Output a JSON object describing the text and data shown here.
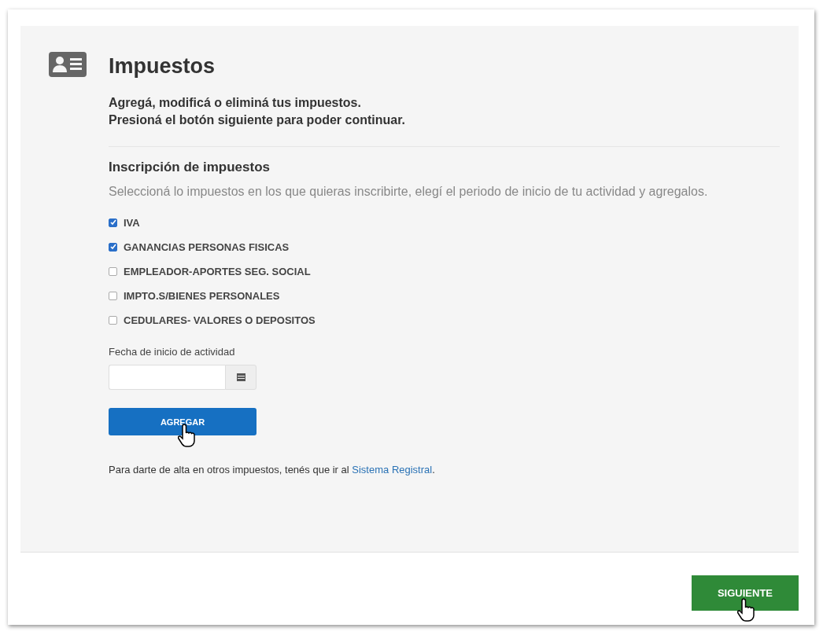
{
  "header": {
    "title": "Impuestos",
    "subtitle": [
      "Agregá, modificá o eliminá tus impuestos.",
      "Presioná el botón siguiente para poder continuar."
    ]
  },
  "section": {
    "title": "Inscripción de impuestos",
    "description": "Seleccioná lo impuestos en los que quieras inscribirte, elegí el periodo de inicio de tu actividad y agregalos.",
    "taxes": [
      {
        "label": "IVA",
        "checked": true
      },
      {
        "label": "GANANCIAS PERSONAS FISICAS",
        "checked": true
      },
      {
        "label": "EMPLEADOR-APORTES SEG. SOCIAL",
        "checked": false
      },
      {
        "label": "IMPTO.S/BIENES PERSONALES",
        "checked": false
      },
      {
        "label": "CEDULARES- VALORES O DEPOSITOS",
        "checked": false
      }
    ],
    "date_field": {
      "label": "Fecha de inicio de actividad"
    },
    "add_button": "AGREGAR",
    "note": {
      "text": "Para darte de alta en otros impuestos, tenés que ir al",
      "link": "Sistema Registral",
      "end": "."
    }
  },
  "footer": {
    "next_button": "SIGUIENTE"
  }
}
